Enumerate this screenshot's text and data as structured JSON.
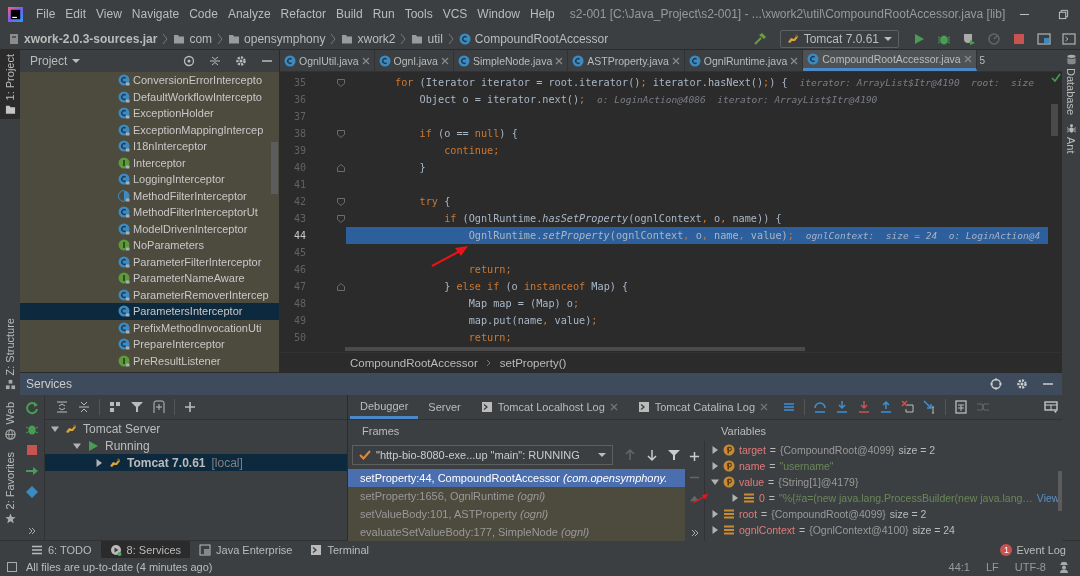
{
  "window": {
    "title": "s2-001 [C:\\Java_Project\\s2-001] - ...\\xwork2\\util\\CompoundRootAccessor.java [lib]"
  },
  "menu": [
    "File",
    "Edit",
    "View",
    "Navigate",
    "Code",
    "Analyze",
    "Refactor",
    "Build",
    "Run",
    "Tools",
    "VCS",
    "Window",
    "Help"
  ],
  "breadcrumbs": [
    {
      "label": "xwork-2.0.3-sources.jar",
      "kind": "jar"
    },
    {
      "label": "com",
      "kind": "folder"
    },
    {
      "label": "opensymphony",
      "kind": "folder"
    },
    {
      "label": "xwork2",
      "kind": "folder"
    },
    {
      "label": "util",
      "kind": "folder"
    },
    {
      "label": "CompoundRootAccessor",
      "kind": "class"
    }
  ],
  "run_config": {
    "label": "Tomcat 7.0.61"
  },
  "left_strip": [
    {
      "label": "1: Project",
      "kind": "project",
      "selected": true
    },
    {
      "label": "Z: Structure",
      "kind": "structure",
      "selected": false
    },
    {
      "label": "Web",
      "kind": "web",
      "selected": false
    },
    {
      "label": "2: Favorites",
      "kind": "favorites",
      "selected": false
    }
  ],
  "right_strip": [
    {
      "label": "Database",
      "kind": "database"
    },
    {
      "label": "Ant",
      "kind": "ant"
    }
  ],
  "project_panel": {
    "title": "Project",
    "items": [
      {
        "label": "ConversionErrorIntercepto",
        "kind": "class",
        "selected": false
      },
      {
        "label": "DefaultWorkflowIntercepto",
        "kind": "class",
        "selected": false
      },
      {
        "label": "ExceptionHolder",
        "kind": "class",
        "selected": false
      },
      {
        "label": "ExceptionMappingIntercep",
        "kind": "class",
        "selected": false
      },
      {
        "label": "I18nInterceptor",
        "kind": "class",
        "selected": false
      },
      {
        "label": "Interceptor",
        "kind": "interface",
        "selected": false
      },
      {
        "label": "LoggingInterceptor",
        "kind": "class",
        "selected": false
      },
      {
        "label": "MethodFilterInterceptor",
        "kind": "abstract",
        "selected": false
      },
      {
        "label": "MethodFilterInterceptorUt",
        "kind": "class",
        "selected": false
      },
      {
        "label": "ModelDrivenInterceptor",
        "kind": "class",
        "selected": false
      },
      {
        "label": "NoParameters",
        "kind": "interface",
        "selected": false
      },
      {
        "label": "ParameterFilterInterceptor",
        "kind": "class",
        "selected": false
      },
      {
        "label": "ParameterNameAware",
        "kind": "interface",
        "selected": false
      },
      {
        "label": "ParameterRemoverIntercep",
        "kind": "class",
        "selected": false
      },
      {
        "label": "ParametersInterceptor",
        "kind": "class",
        "selected": true
      },
      {
        "label": "PrefixMethodInvocationUti",
        "kind": "class",
        "selected": false
      },
      {
        "label": "PrepareInterceptor",
        "kind": "class",
        "selected": false
      },
      {
        "label": "PreResultListener",
        "kind": "interface",
        "selected": false
      }
    ]
  },
  "editor_tabs": [
    {
      "label": "OgnlUtil.java",
      "selected": false
    },
    {
      "label": "Ognl.java",
      "selected": false
    },
    {
      "label": "SimpleNode.java",
      "selected": false
    },
    {
      "label": "ASTProperty.java",
      "selected": false
    },
    {
      "label": "OgnlRuntime.java",
      "selected": false
    },
    {
      "label": "CompoundRootAccessor.java",
      "selected": true
    }
  ],
  "hidden_tab_count": "5",
  "code_lines": [
    {
      "number": "35",
      "fold_start": true,
      "fold_end": false,
      "current": false,
      "segments": [
        {
          "text": "        for",
          "kind": "kw"
        },
        {
          "text": " (Iterator iterator = root.iterator()",
          "kind": "plain"
        },
        {
          "text": ";",
          "kind": "kw"
        },
        {
          "text": " iterator.hasNext()",
          "kind": "plain"
        },
        {
          "text": ";",
          "kind": "kw"
        },
        {
          "text": ") { ",
          "kind": "plain"
        },
        {
          "text": " iterator: ArrayList$Itr@4190  root:  size",
          "kind": "hint"
        }
      ]
    },
    {
      "number": "36",
      "fold_start": false,
      "fold_end": false,
      "current": false,
      "segments": [
        {
          "text": "            Object o = iterator.next()",
          "kind": "plain"
        },
        {
          "text": "; ",
          "kind": "kw"
        },
        {
          "text": " o: LoginAction@4086  iterator: ArrayList$Itr@4190",
          "kind": "hint"
        }
      ]
    },
    {
      "number": "37",
      "fold_start": false,
      "fold_end": false,
      "current": false
    },
    {
      "number": "38",
      "fold_start": true,
      "fold_end": false,
      "current": false,
      "segments": [
        {
          "text": "            if",
          "kind": "kw"
        },
        {
          "text": " (o == ",
          "kind": "plain"
        },
        {
          "text": "null",
          "kind": "kw"
        },
        {
          "text": ") {",
          "kind": "plain"
        }
      ]
    },
    {
      "number": "39",
      "fold_start": false,
      "fold_end": false,
      "current": false,
      "segments": [
        {
          "text": "                continue;",
          "kind": "kw"
        }
      ]
    },
    {
      "number": "40",
      "fold_start": false,
      "fold_end": true,
      "current": false,
      "segments": [
        {
          "text": "            }",
          "kind": "plain"
        }
      ]
    },
    {
      "number": "41",
      "fold_start": false,
      "fold_end": false,
      "current": false
    },
    {
      "number": "42",
      "fold_start": true,
      "fold_end": false,
      "current": false,
      "segments": [
        {
          "text": "            try",
          "kind": "kw"
        },
        {
          "text": " {",
          "kind": "plain"
        }
      ]
    },
    {
      "number": "43",
      "fold_start": true,
      "fold_end": false,
      "current": false,
      "segments": [
        {
          "text": "                if",
          "kind": "kw"
        },
        {
          "text": " (OgnlRuntime.",
          "kind": "plain"
        },
        {
          "text": "hasSetProperty",
          "kind": "call"
        },
        {
          "text": "(ognlContext",
          "kind": "plain"
        },
        {
          "text": ",",
          "kind": "kw"
        },
        {
          "text": " o",
          "kind": "plain"
        },
        {
          "text": ",",
          "kind": "kw"
        },
        {
          "text": " name)) {",
          "kind": "plain"
        }
      ]
    },
    {
      "number": "44",
      "fold_start": false,
      "fold_end": false,
      "current": true,
      "segments": [
        {
          "text": "                    OgnlRuntime.",
          "kind": "plain"
        },
        {
          "text": "setProperty",
          "kind": "call"
        },
        {
          "text": "(ognlContext",
          "kind": "plain"
        },
        {
          "text": ",",
          "kind": "kw"
        },
        {
          "text": " o",
          "kind": "plain"
        },
        {
          "text": ",",
          "kind": "kw"
        },
        {
          "text": " name",
          "kind": "plain"
        },
        {
          "text": ",",
          "kind": "kw"
        },
        {
          "text": " value)",
          "kind": "plain"
        },
        {
          "text": "; ",
          "kind": "kw"
        },
        {
          "text": " ognlContext:  size = 24  o: LoginAction@4",
          "kind": "hint"
        }
      ]
    },
    {
      "number": "45",
      "fold_start": false,
      "fold_end": false,
      "current": false
    },
    {
      "number": "46",
      "fold_start": false,
      "fold_end": false,
      "current": false,
      "segments": [
        {
          "text": "                    return;",
          "kind": "kw"
        }
      ]
    },
    {
      "number": "47",
      "fold_start": false,
      "fold_end": true,
      "current": false,
      "segments": [
        {
          "text": "                } ",
          "kind": "plain"
        },
        {
          "text": "else if",
          "kind": "kw"
        },
        {
          "text": " (o ",
          "kind": "plain"
        },
        {
          "text": "instanceof",
          "kind": "kw"
        },
        {
          "text": " Map) {",
          "kind": "plain"
        }
      ]
    },
    {
      "number": "48",
      "fold_start": false,
      "fold_end": false,
      "current": false,
      "segments": [
        {
          "text": "                    Map map = (Map) o",
          "kind": "plain"
        },
        {
          "text": ";",
          "kind": "kw"
        }
      ]
    },
    {
      "number": "49",
      "fold_start": false,
      "fold_end": false,
      "current": false,
      "segments": [
        {
          "text": "                    map.put(name",
          "kind": "plain"
        },
        {
          "text": ",",
          "kind": "kw"
        },
        {
          "text": " value)",
          "kind": "plain"
        },
        {
          "text": ";",
          "kind": "kw"
        }
      ]
    },
    {
      "number": "50",
      "fold_start": false,
      "fold_end": false,
      "current": false,
      "segments": [
        {
          "text": "                    return;",
          "kind": "kw"
        }
      ]
    }
  ],
  "editor_breadcrumbs": [
    "CompoundRootAccessor",
    "setProperty()"
  ],
  "services": {
    "title": "Services",
    "tree": [
      {
        "label": "Tomcat Server",
        "kind": "server",
        "expanded": true,
        "selected": false,
        "children": [
          {
            "label": "Running",
            "kind": "running",
            "expanded": true,
            "selected": false,
            "children": [
              {
                "label": "Tomcat 7.0.61",
                "suffix": "[local]",
                "kind": "instance",
                "expanded": false,
                "selected": true
              }
            ]
          }
        ]
      }
    ]
  },
  "debugger": {
    "tabs": [
      {
        "label": "Debugger",
        "selected": true,
        "closable": false
      },
      {
        "label": "Server",
        "selected": false,
        "closable": false
      },
      {
        "label": "Tomcat Localhost Log",
        "selected": false,
        "closable": true
      },
      {
        "label": "Tomcat Catalina Log",
        "selected": false,
        "closable": true
      }
    ],
    "frames_title": "Frames",
    "thread": "\"http-bio-8080-exe...up \"main\": RUNNING",
    "frames": [
      {
        "label": "setProperty:44, CompoundRootAccessor *(com.opensymphony.*",
        "library": false,
        "selected": true
      },
      {
        "label": "setProperty:1656, OgnlRuntime *(ognl)*",
        "library": true,
        "selected": false
      },
      {
        "label": "setValueBody:101, ASTProperty *(ognl)*",
        "library": true,
        "selected": false
      },
      {
        "label": "evaluateSetValueBody:177, SimpleNode *(ognl)*",
        "library": true,
        "selected": false
      }
    ],
    "variables_title": "Variables",
    "variables": [
      {
        "name": "target",
        "operator": "=",
        "value": "{CompoundRoot@4099}",
        "size": "size = 2",
        "kind": "field",
        "is_string": false,
        "expanded": false
      },
      {
        "name": "name",
        "operator": "=",
        "value": "\"username\"",
        "kind": "field",
        "is_string": true,
        "expanded": false
      },
      {
        "name": "value",
        "operator": "=",
        "value": "{String[1]@4179}",
        "kind": "field",
        "is_string": false,
        "expanded": true,
        "children": [
          {
            "name": "0",
            "operator": "=",
            "value": "\"%{#a=(new java.lang.ProcessBuilder(new java.lang…",
            "link": "View",
            "kind": "local",
            "is_string": true,
            "expanded": false
          }
        ]
      },
      {
        "name": "root",
        "operator": "=",
        "value": "{CompoundRoot@4099}",
        "size": "size = 2",
        "kind": "local",
        "is_string": false,
        "expanded": false
      },
      {
        "name": "ognlContext",
        "operator": "=",
        "value": "{OgnlContext@4100}",
        "size": "size = 24",
        "kind": "local",
        "is_string": false,
        "expanded": false
      }
    ]
  },
  "bottom_tabs": [
    {
      "label": "6: TODO",
      "kind": "todo",
      "selected": false
    },
    {
      "label": "8: Services",
      "kind": "services",
      "selected": true
    },
    {
      "label": "Java Enterprise",
      "kind": "enterprise",
      "selected": false
    },
    {
      "label": "Terminal",
      "kind": "terminal",
      "selected": false
    }
  ],
  "event_log": {
    "label": "Event Log",
    "count": "1"
  },
  "status": {
    "message": "All files are up-to-date (4 minutes ago)",
    "position": "44:1",
    "line_ending": "LF",
    "encoding": "UTF-8"
  }
}
